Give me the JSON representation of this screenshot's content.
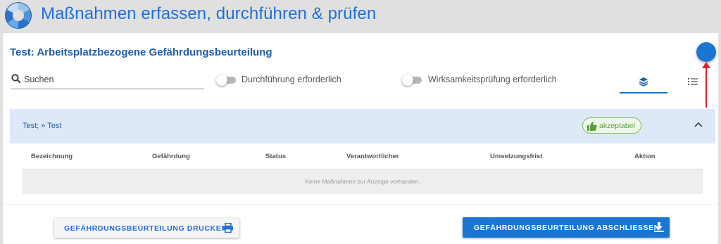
{
  "app": {
    "title": "Maßnahmen erfassen, durchführen & prüfen",
    "logo_icon": "circular-segments-logo",
    "accent_color": "#1976d2"
  },
  "page": {
    "title": "Test: Arbeitsplatzbezogene Gefährdungsbeurteilung"
  },
  "toolbar": {
    "search": {
      "placeholder": "Suchen",
      "value": "",
      "icon": "search-icon"
    },
    "toggles": [
      {
        "label": "Durchführung erforderlich",
        "checked": false
      },
      {
        "label": "Wirksamkeitsprüfung erforderlich",
        "checked": false
      }
    ],
    "view_tabs": [
      {
        "icon": "layers-icon",
        "active": true
      },
      {
        "icon": "list-icon",
        "active": false
      }
    ]
  },
  "panel": {
    "title": "Test; » Test",
    "badge": {
      "label": "akzeptabel",
      "icon": "thumbs-up-icon",
      "color": "#5a9e3b"
    },
    "expanded": true,
    "table": {
      "columns": [
        "Bezeichnung",
        "Gefährdung",
        "Status",
        "Verantwortlicher",
        "Umsetzungsfrist",
        "Aktion"
      ],
      "rows": [],
      "empty_text": "Keine Maßnahmen zur Anzeige vorhanden."
    }
  },
  "actions": {
    "print_label": "GEFÄHRDUNGSBEURTEILUNG DRUCKEN",
    "print_icon": "printer-icon",
    "close_label": "GEFÄHRDUNGSBEURTEILUNG ABSCHLIESSEN",
    "close_icon": "download-icon"
  },
  "annotation": {
    "color": "#e0202a",
    "icon": "red-arrow-up-icon"
  }
}
